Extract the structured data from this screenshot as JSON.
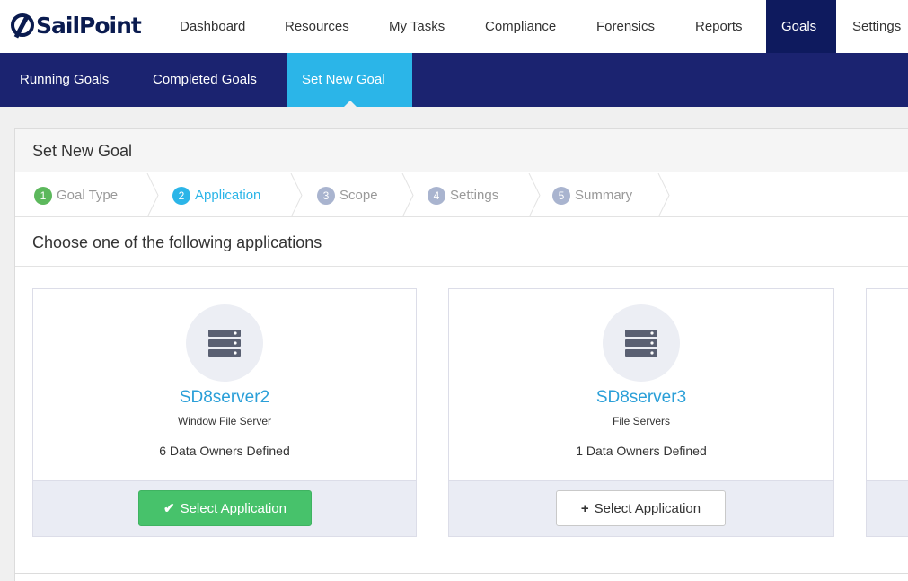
{
  "brand": {
    "logo_text": "SailPoint"
  },
  "topnav": {
    "items": [
      {
        "label": "Dashboard"
      },
      {
        "label": "Resources"
      },
      {
        "label": "My Tasks"
      },
      {
        "label": "Compliance"
      },
      {
        "label": "Forensics"
      },
      {
        "label": "Reports"
      },
      {
        "label": "Goals",
        "active": true
      },
      {
        "label": "Settings"
      }
    ]
  },
  "subnav": {
    "items": [
      {
        "label": "Running Goals"
      },
      {
        "label": "Completed Goals"
      },
      {
        "label": "Set New Goal",
        "active": true
      }
    ]
  },
  "panel": {
    "title": "Set New Goal",
    "steps": [
      {
        "num": "1",
        "label": "Goal Type",
        "state": "done"
      },
      {
        "num": "2",
        "label": "Application",
        "state": "current"
      },
      {
        "num": "3",
        "label": "Scope",
        "state": "pending"
      },
      {
        "num": "4",
        "label": "Settings",
        "state": "pending"
      },
      {
        "num": "5",
        "label": "Summary",
        "state": "pending"
      }
    ],
    "heading": "Choose one of the following applications"
  },
  "applications": [
    {
      "name": "SD8server2",
      "type": "Window File Server",
      "owners": "6 Data Owners Defined",
      "button_label": "Select Application",
      "selected": true,
      "button_icon": "check-icon"
    },
    {
      "name": "SD8server3",
      "type": "File Servers",
      "owners": "1 Data Owners Defined",
      "button_label": "Select Application",
      "selected": false,
      "button_icon": "plus-icon"
    }
  ],
  "colors": {
    "nav_dark": "#0e1a5e",
    "subnav_bg": "#1b2370",
    "accent": "#2bb5e8",
    "success": "#47c26b",
    "step_done": "#5cb85c"
  }
}
